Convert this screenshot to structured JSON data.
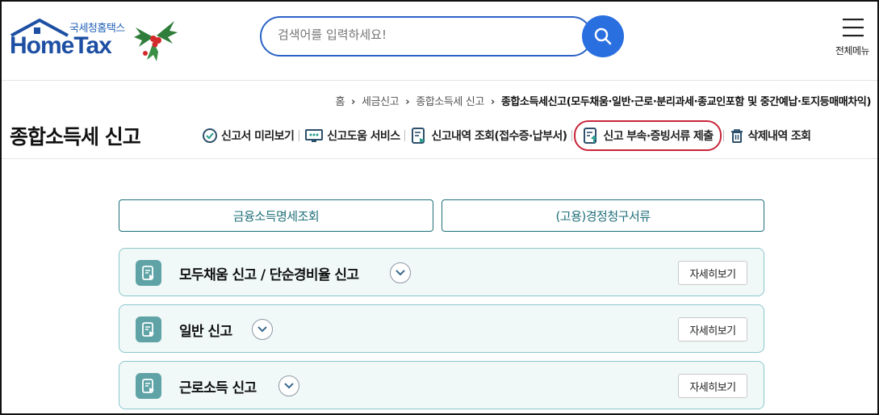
{
  "header": {
    "logo_sub": "국세청홈택스",
    "logo_main": "HomeTax",
    "search_placeholder": "검색어를 입력하세요!",
    "menu_label": "전체메뉴"
  },
  "breadcrumb": {
    "items": [
      "홈",
      "세금신고",
      "종합소득세 신고"
    ],
    "current": "종합소득세신고(모두채움·일반·근로·분리과세·종교인포함 및 중간예납·토지등매매차익)"
  },
  "page": {
    "title": "종합소득세 신고"
  },
  "actions": [
    {
      "label": "신고서 미리보기",
      "icon": "preview-icon"
    },
    {
      "label": "신고도움 서비스",
      "icon": "monitor-help-icon"
    },
    {
      "label": "신고내역 조회(접수증·납부서)",
      "icon": "document-search-icon"
    },
    {
      "label": "신고 부속·증빙서류 제출",
      "icon": "document-upload-icon"
    },
    {
      "label": "삭제내역 조회",
      "icon": "trash-icon"
    }
  ],
  "top_buttons": [
    {
      "label": "금융소득명세조회"
    },
    {
      "label": "(고용)경정청구서류"
    }
  ],
  "cards": [
    {
      "title": "모두채움 신고 / 단순경비율 신고",
      "detail": "자세히보기"
    },
    {
      "title": "일반 신고",
      "detail": "자세히보기"
    },
    {
      "title": "근로소득 신고",
      "detail": "자세히보기"
    }
  ],
  "colors": {
    "brand_blue": "#1d4fa3",
    "search_blue": "#2a6fe0",
    "teal": "#1f6f7a",
    "highlight_red": "#c9243a",
    "card_bg": "#f1f8f8"
  }
}
